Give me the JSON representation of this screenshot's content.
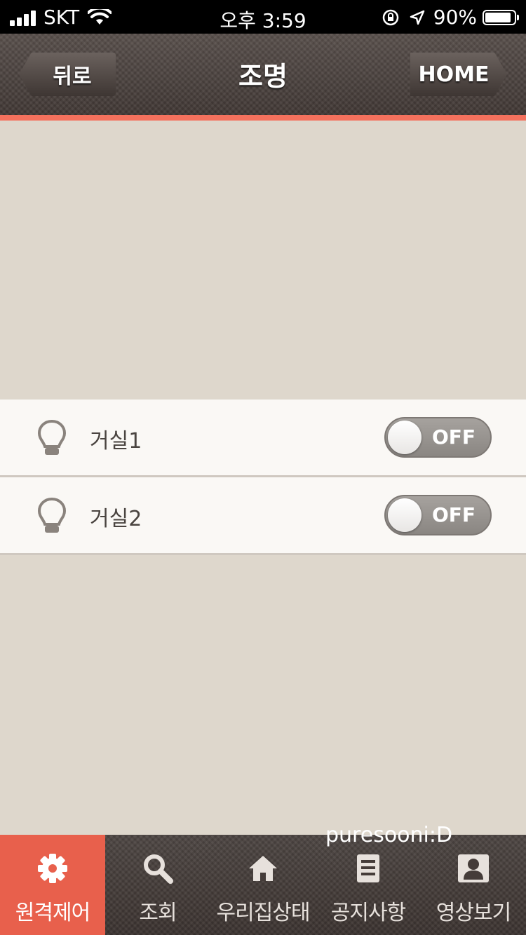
{
  "status_bar": {
    "carrier": "SKT",
    "time": "오후 3:59",
    "battery": "90%",
    "battery_level": 0.9
  },
  "header": {
    "title": "조명",
    "back_label": "뒤로",
    "home_label": "HOME",
    "accent_color": "#f4715d"
  },
  "lights": [
    {
      "label": "거실1",
      "state": "OFF"
    },
    {
      "label": "거실2",
      "state": "OFF"
    }
  ],
  "watermark": "puresooni:D",
  "tabs": [
    {
      "label": "원격제어",
      "icon": "gear-icon",
      "active": true
    },
    {
      "label": "조회",
      "icon": "search-icon",
      "active": false
    },
    {
      "label": "우리집상태",
      "icon": "house-icon",
      "active": false
    },
    {
      "label": "공지사항",
      "icon": "document-icon",
      "active": false
    },
    {
      "label": "영상보기",
      "icon": "person-icon",
      "active": false
    }
  ],
  "colors": {
    "active_tab": "#e8604c",
    "background": "#ded7cc"
  }
}
